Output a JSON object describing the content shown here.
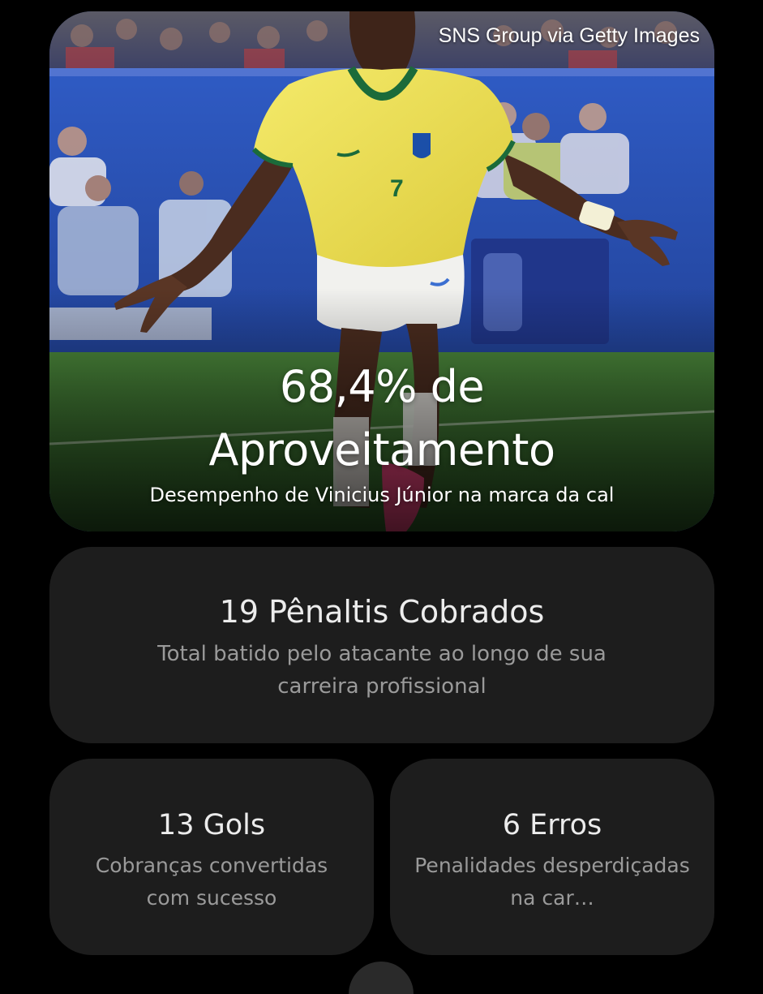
{
  "hero": {
    "credit": "SNS Group via Getty Images",
    "title_line1": "68,4% de",
    "title_line2": "Aproveitamento",
    "subtitle": "Desempenho de Vinicius Júnior na marca da cal",
    "jersey_number": "7"
  },
  "stats": {
    "total": {
      "title": "19 Pênaltis Cobrados",
      "description": "Total batido pelo atacante ao longo de sua carreira profissional"
    },
    "goals": {
      "title": "13 Gols",
      "description": "Cobranças convertidas com sucesso"
    },
    "misses": {
      "title": "6 Erros",
      "description": "Penalidades desperdiçadas na car…"
    }
  },
  "colors": {
    "background": "#000000",
    "card": "#1d1d1d",
    "title_text": "#ececec",
    "muted_text": "#9a9a9a",
    "jersey_yellow": "#f2e35a",
    "pitch_green": "#3f7a34",
    "board_blue": "#2a4fb4"
  }
}
